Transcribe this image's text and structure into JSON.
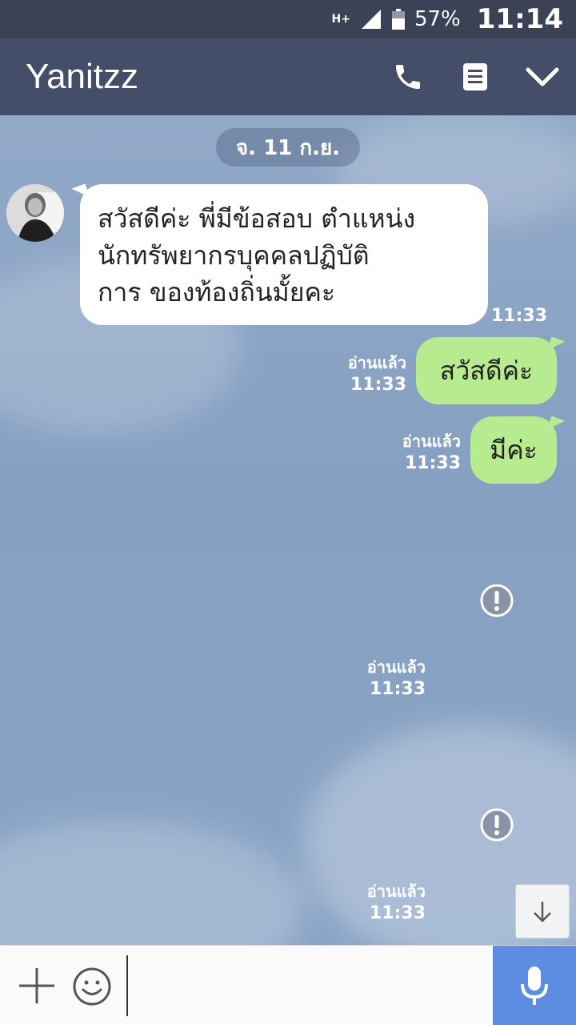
{
  "status_bar": {
    "network": "H+",
    "battery_percent": "57%",
    "time": "11:14"
  },
  "header": {
    "title": "Yanitzz"
  },
  "chat": {
    "date": "จ. 11 ก.ย.",
    "incoming": {
      "lines": [
        "สวัสดีค่ะ พี่มีข้อสอบ ตำแหน่ง",
        "นักทรัพยากรบุคคลปฏิบัติ",
        "การ ของท้องถิ่นมั้ยคะ"
      ],
      "time": "11:33"
    },
    "outgoing": [
      {
        "text": "สวัสดีค่ะ",
        "read": "อ่านแล้ว",
        "time": "11:33"
      },
      {
        "text": "มีค่ะ",
        "read": "อ่านแล้ว",
        "time": "11:33"
      }
    ],
    "failed": [
      {
        "read": "อ่านแล้ว",
        "time": "11:33"
      },
      {
        "read": "อ่านแล้ว",
        "time": "11:33"
      }
    ]
  },
  "input": {
    "placeholder": ""
  },
  "colors": {
    "status_bar": "#3b4256",
    "header": "#454e68",
    "outgoing_bubble": "#b6eb8f",
    "mic_button": "#5d8de0"
  }
}
